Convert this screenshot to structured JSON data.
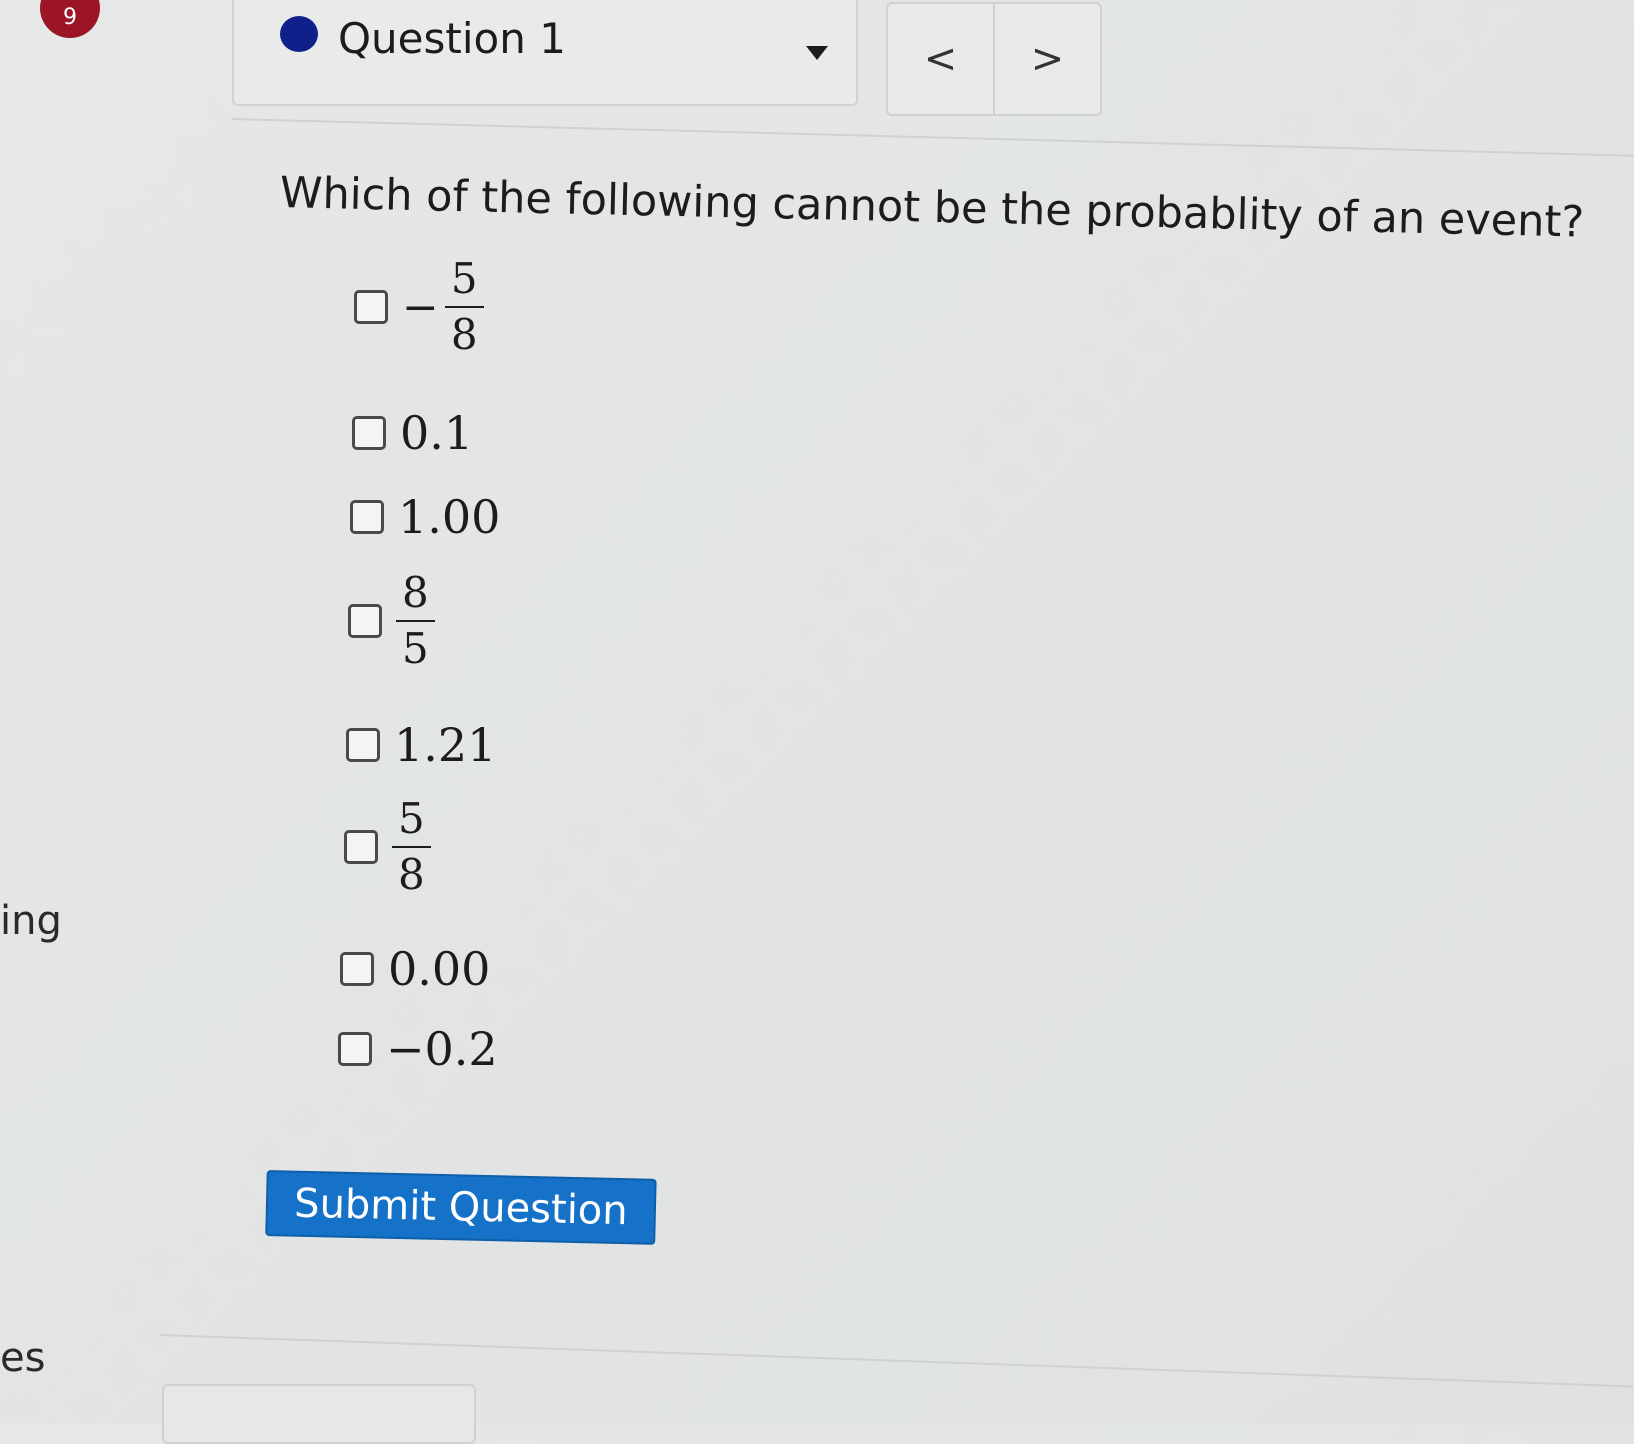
{
  "sidebar": {
    "badge": "9",
    "fragment_1": "ing",
    "fragment_2": "es"
  },
  "header": {
    "question_label": "Question 1",
    "status_dot_color": "#10208a",
    "prev_label": "<",
    "next_label": ">"
  },
  "question": {
    "prompt": "Which of the following cannot be the probablity of an event?",
    "options": [
      {
        "type": "fraction",
        "sign": "−",
        "numerator": "5",
        "denominator": "8",
        "checked": false
      },
      {
        "type": "text",
        "text": "0.1",
        "checked": false
      },
      {
        "type": "text",
        "text": "1.00",
        "checked": false
      },
      {
        "type": "fraction",
        "sign": "",
        "numerator": "8",
        "denominator": "5",
        "checked": false
      },
      {
        "type": "text",
        "text": "1.21",
        "checked": false
      },
      {
        "type": "fraction",
        "sign": "",
        "numerator": "5",
        "denominator": "8",
        "checked": false
      },
      {
        "type": "text",
        "text": "0.00",
        "checked": false
      },
      {
        "type": "text",
        "text": "−0.2",
        "checked": false
      }
    ]
  },
  "submit": {
    "label": "Submit Question",
    "color": "#1672c8"
  }
}
